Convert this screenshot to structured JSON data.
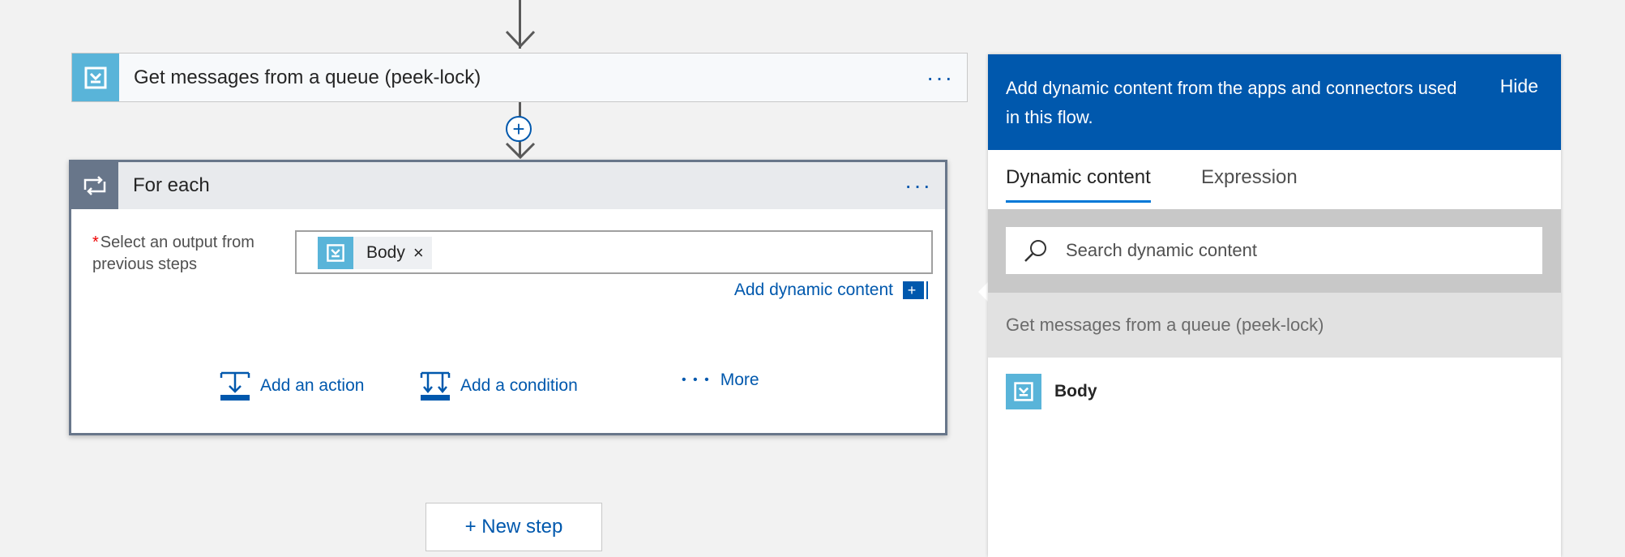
{
  "trigger_step": {
    "title": "Get messages from a queue (peek-lock)",
    "menu": "···",
    "icon": "service-bus-queue-icon"
  },
  "foreach_step": {
    "title": "For each",
    "menu": "···",
    "icon": "loop-icon",
    "field_label": "Select an output from previous steps",
    "required_marker": "*",
    "token": {
      "label": "Body",
      "close": "×",
      "icon": "service-bus-queue-icon"
    },
    "add_dynamic_label": "Add dynamic content",
    "add_dynamic_icon": "+",
    "actions": {
      "add_action": "Add an action",
      "add_condition": "Add a condition",
      "more_dots": "• • •",
      "more": "More"
    }
  },
  "insert_step_icon": "+",
  "new_step": "+ New step",
  "dynamic_panel": {
    "header_text": "Add dynamic content from the apps and connectors used in this flow.",
    "hide": "Hide",
    "tabs": [
      {
        "label": "Dynamic content",
        "active": true
      },
      {
        "label": "Expression",
        "active": false
      }
    ],
    "search_placeholder": "Search dynamic content",
    "group_title": "Get messages from a queue (peek-lock)",
    "items": [
      {
        "label": "Body",
        "icon": "service-bus-queue-icon"
      }
    ]
  },
  "colors": {
    "accent": "#0058ad",
    "queue_icon_bg": "#59b4d9",
    "loop_icon_bg": "#68768a",
    "canvas_bg": "#f2f2f2"
  }
}
